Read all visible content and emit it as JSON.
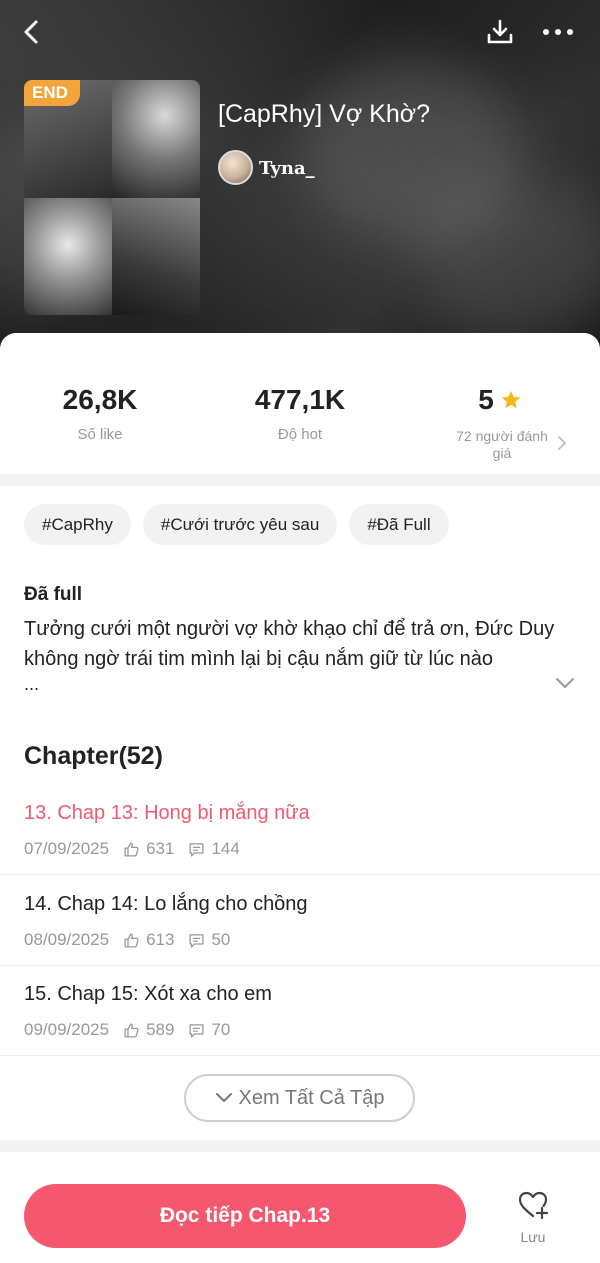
{
  "header": {
    "badge": "END",
    "title": "[CapRhy] Vợ Khờ?",
    "author": "Tyna_"
  },
  "stats": {
    "likes": {
      "value": "26,8K",
      "label": "Số like"
    },
    "hot": {
      "value": "477,1K",
      "label": "Độ hot"
    },
    "rating": {
      "value": "5",
      "label": "72 người đánh giá"
    }
  },
  "tags": [
    "#CapRhy",
    "#Cưới trước yêu sau",
    "#Đã Full"
  ],
  "description": {
    "heading": "Đã full",
    "body": "Tưởng cưới một người vợ khờ khạo chỉ để trả ơn, Đức Duy không ngờ trái tim mình lại bị cậu nắm giữ từ lúc nào",
    "ellipsis": "..."
  },
  "chapters": {
    "title": "Chapter(52)",
    "items": [
      {
        "title": "13. Chap 13: Hong bị mắng nữa",
        "date": "07/09/2025",
        "likes": "631",
        "comments": "144"
      },
      {
        "title": "14. Chap 14: Lo lắng cho chồng",
        "date": "08/09/2025",
        "likes": "613",
        "comments": "50"
      },
      {
        "title": "15. Chap 15: Xót xa cho em",
        "date": "09/09/2025",
        "likes": "589",
        "comments": "70"
      }
    ],
    "view_all": "Xem Tất Cả Tập"
  },
  "bottom": {
    "read_button": "Đọc tiếp Chap.13",
    "save_label": "Lưu"
  },
  "colors": {
    "accent": "#f5586e",
    "active_chapter": "#f05a72",
    "badge": "#f3a43a",
    "star": "#f6b91a"
  },
  "icons": [
    "back-arrow-icon",
    "download-icon",
    "more-icon",
    "star-icon",
    "chevron-right-icon",
    "chevron-down-icon",
    "like-icon",
    "comment-icon",
    "heart-plus-icon"
  ]
}
